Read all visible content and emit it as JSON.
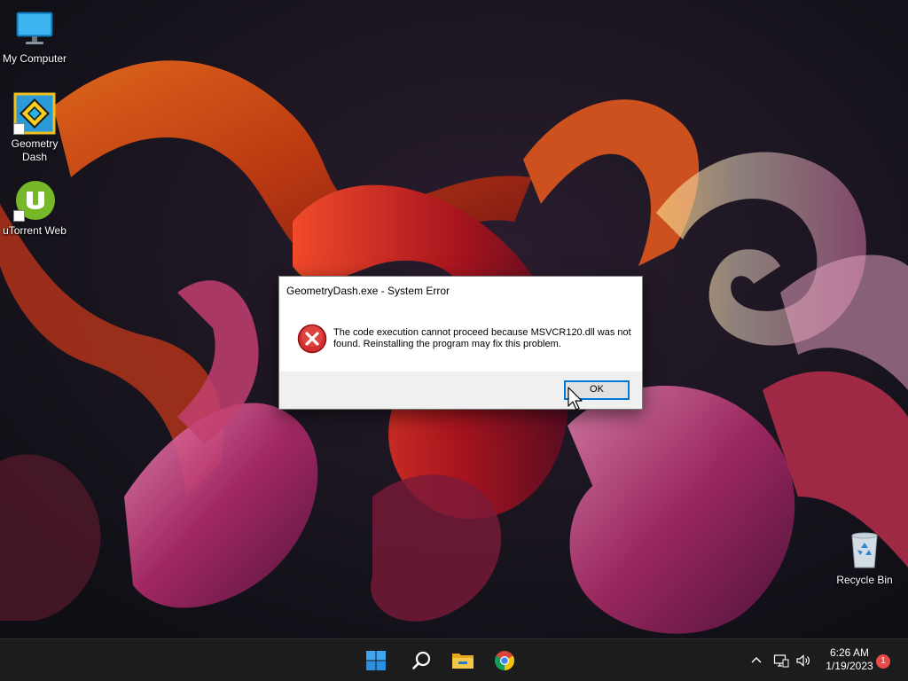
{
  "desktop": {
    "icons": [
      {
        "label": "My Computer",
        "icon": "monitor-icon"
      },
      {
        "label": "Geometry Dash",
        "icon": "geometry-dash-icon"
      },
      {
        "label": "uTorrent Web",
        "icon": "utorrent-icon"
      },
      {
        "label": "Recycle Bin",
        "icon": "recycle-bin-icon"
      }
    ]
  },
  "dialog": {
    "title": "GeometryDash.exe - System Error",
    "message": "The code execution cannot proceed because MSVCR120.dll was not found. Reinstalling the program may fix this problem.",
    "icon": "error-icon",
    "ok_label": "OK"
  },
  "taskbar": {
    "apps": [
      "start-icon",
      "search-icon",
      "file-explorer-icon",
      "chrome-icon"
    ],
    "tray": {
      "time": "6:26 AM",
      "date": "1/19/2023",
      "notification_count": "1"
    }
  },
  "colors": {
    "accent": "#0078d7",
    "error": "#d32f2f",
    "taskbar": "#1c1c1c",
    "badge": "#e84a4a"
  }
}
